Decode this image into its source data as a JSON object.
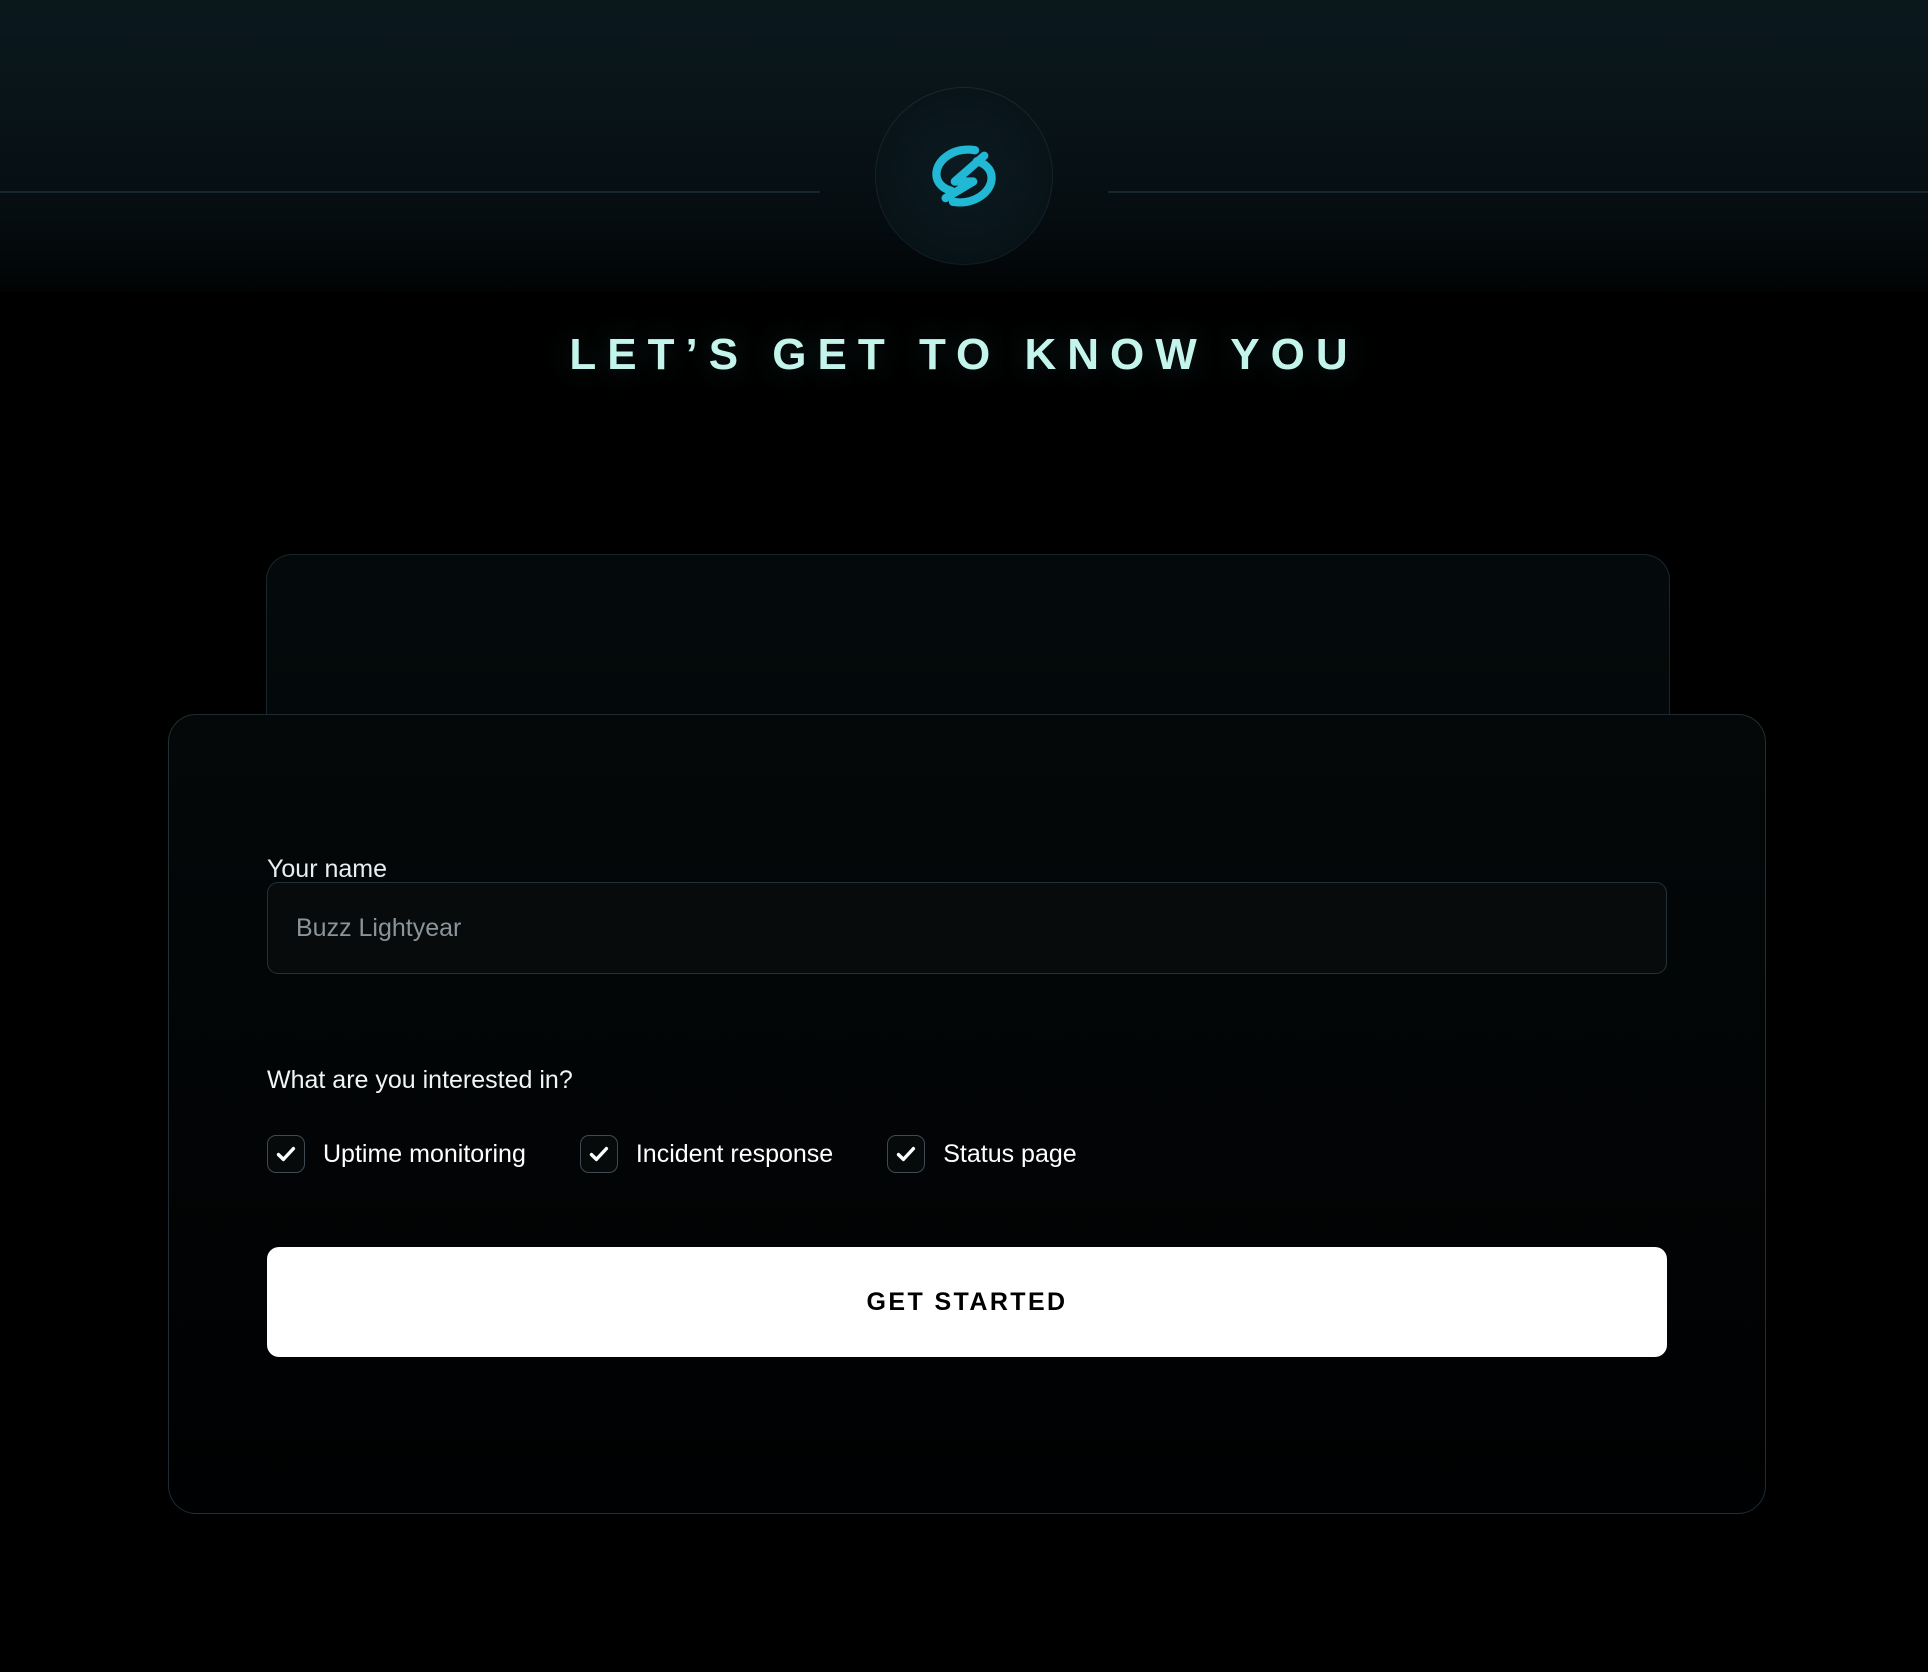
{
  "brand": {
    "logo_icon": "swirl-bolt-logo-icon",
    "logo_color": "#20b8d4",
    "accent_color": "#c3f5ec"
  },
  "header": {
    "title": "LET’S GET TO KNOW YOU"
  },
  "form": {
    "name_field": {
      "label": "Your name",
      "placeholder": "Buzz Lightyear",
      "value": ""
    },
    "interests": {
      "question": "What are you interested in?",
      "options": [
        {
          "label": "Uptime monitoring",
          "checked": true
        },
        {
          "label": "Incident response",
          "checked": true
        },
        {
          "label": "Status page",
          "checked": true
        }
      ]
    },
    "submit": {
      "label": "Get started"
    }
  }
}
